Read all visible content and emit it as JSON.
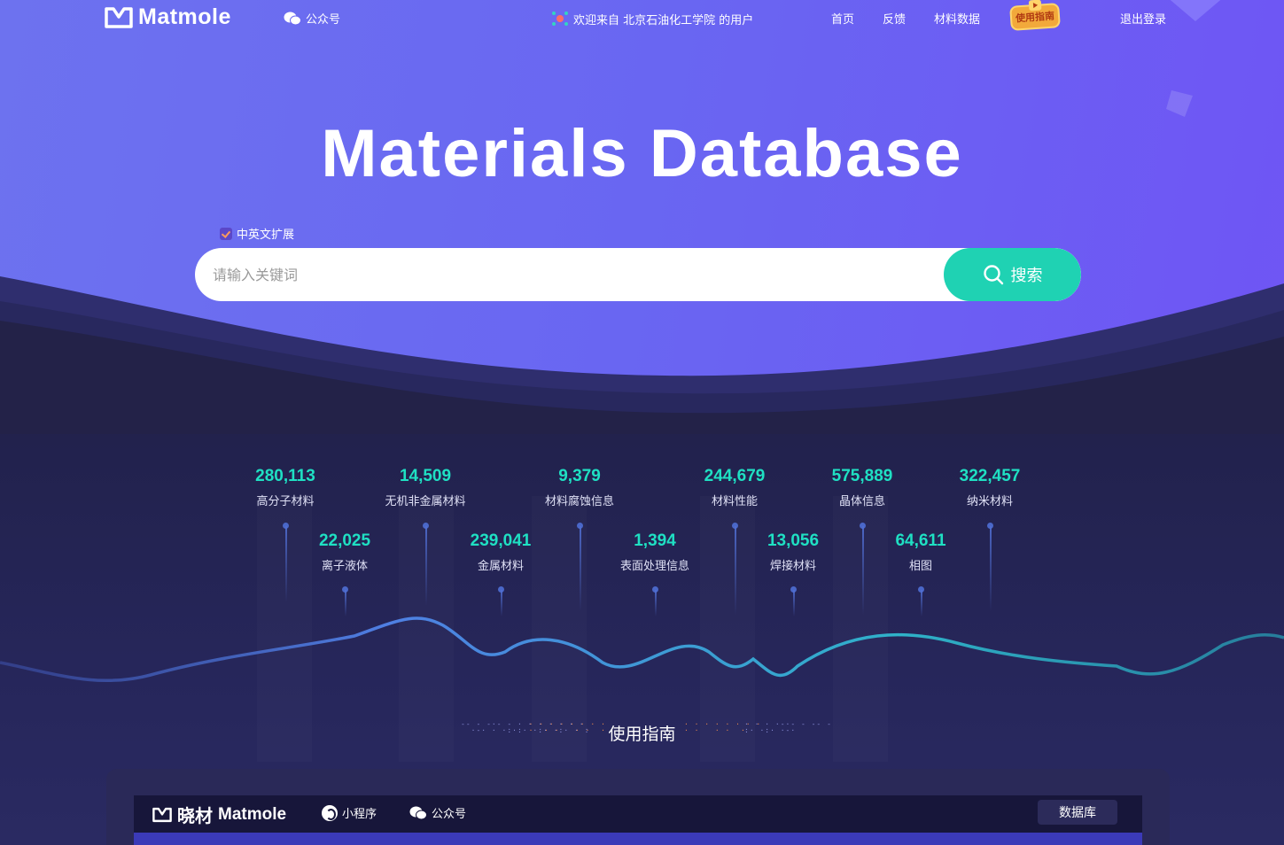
{
  "nav": {
    "logo_text": "Matmole",
    "wechat_label": "公众号",
    "welcome": "欢迎来自 北京石油化工学院 的用户",
    "home": "首页",
    "feedback": "反馈",
    "materials_data": "材料数据",
    "guide_badge": "使用指南",
    "logout": "退出登录"
  },
  "hero": {
    "title": "Materials Database"
  },
  "search": {
    "extension_label": "中英文扩展",
    "extension_checked": true,
    "placeholder": "请输入关键词",
    "value": "",
    "button_label": "搜索"
  },
  "stats_top": [
    {
      "value": "280,113",
      "label": "高分子材料"
    },
    {
      "value": "14,509",
      "label": "无机非金属材料"
    },
    {
      "value": "9,379",
      "label": "材料腐蚀信息"
    },
    {
      "value": "244,679",
      "label": "材料性能"
    },
    {
      "value": "575,889",
      "label": "晶体信息"
    },
    {
      "value": "322,457",
      "label": "纳米材料"
    }
  ],
  "stats_bottom": [
    {
      "value": "22,025",
      "label": "离子液体"
    },
    {
      "value": "239,041",
      "label": "金属材料"
    },
    {
      "value": "1,394",
      "label": "表面处理信息"
    },
    {
      "value": "13,056",
      "label": "焊接材料"
    },
    {
      "value": "64,611",
      "label": "相图"
    }
  ],
  "guide": {
    "heading": "使用指南"
  },
  "preview": {
    "logo_cn": "晓材",
    "logo_en": "Matmole",
    "mini_program": "小程序",
    "official_account": "公众号",
    "database_button": "数据库"
  },
  "colors": {
    "accent": "#1fd2b3",
    "stat_value": "#1fe0c3",
    "hero_bg": "#6a68f2",
    "dark_bg": "#232248"
  }
}
